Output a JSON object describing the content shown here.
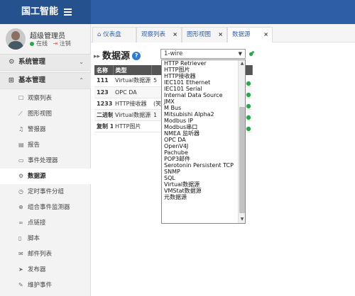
{
  "app": {
    "title": "国工智能"
  },
  "user": {
    "name": "超级管理员",
    "status": "在线",
    "logout": "注销"
  },
  "sidebar": {
    "group1": {
      "label": "系统管理"
    },
    "group2": {
      "label": "基本管理"
    },
    "items": [
      {
        "label": "观察列表",
        "icon": "list-icon"
      },
      {
        "label": "图形视图",
        "icon": "chart-icon"
      },
      {
        "label": "警报器",
        "icon": "bell-icon"
      },
      {
        "label": "报告",
        "icon": "report-icon"
      },
      {
        "label": "事件处理器",
        "icon": "handler-icon"
      },
      {
        "label": "数据源",
        "icon": "gear-icon"
      },
      {
        "label": "定时事件分组",
        "icon": "clock-icon"
      },
      {
        "label": "组合事件监测器",
        "icon": "plus-icon"
      },
      {
        "label": "点链接",
        "icon": "link-icon"
      },
      {
        "label": "脚本",
        "icon": "script-icon"
      },
      {
        "label": "邮件列表",
        "icon": "mail-icon"
      },
      {
        "label": "发布器",
        "icon": "publish-icon"
      },
      {
        "label": "维护事件",
        "icon": "wrench-icon"
      }
    ]
  },
  "tabs": [
    {
      "label": "仪表盘"
    },
    {
      "label": "观察列表"
    },
    {
      "label": "图形视图"
    },
    {
      "label": "数据源"
    }
  ],
  "page": {
    "title": "数据源"
  },
  "select": {
    "value": "1-wire"
  },
  "table": {
    "headers": [
      "名称",
      "类型",
      ""
    ],
    "rows": [
      [
        "111",
        "Virtual数据源",
        "5"
      ],
      [
        "123",
        "OPC DA",
        ""
      ],
      [
        "1233",
        "HTTP接收器",
        "(笑"
      ],
      [
        "二进制",
        "Virtual数据源",
        "1"
      ],
      [
        "复制 1",
        "HTTP图片",
        ""
      ]
    ]
  },
  "dropdown": {
    "options": [
      "HTTP Retriever",
      "HTTP图片",
      "HTTP接收器",
      "IEC101 Ethernet",
      "IEC101 Serial",
      "Internal Data Source",
      "JMX",
      "M Bus",
      "Mitsubishi Alpha2",
      "Modbus IP",
      "Modbus串口",
      "NMEA 监听器",
      "OPC DA",
      "OpenV4J",
      "Pachube",
      "POP3邮件",
      "Serotonin Persistent TCP",
      "SNMP",
      "SQL",
      "Virtual数据源",
      "VMStat数据源",
      "元数据源"
    ]
  },
  "colors": {
    "topbar": "#2e5ea5",
    "accent": "#2e7bcf",
    "enabled": "#2ea44f"
  }
}
